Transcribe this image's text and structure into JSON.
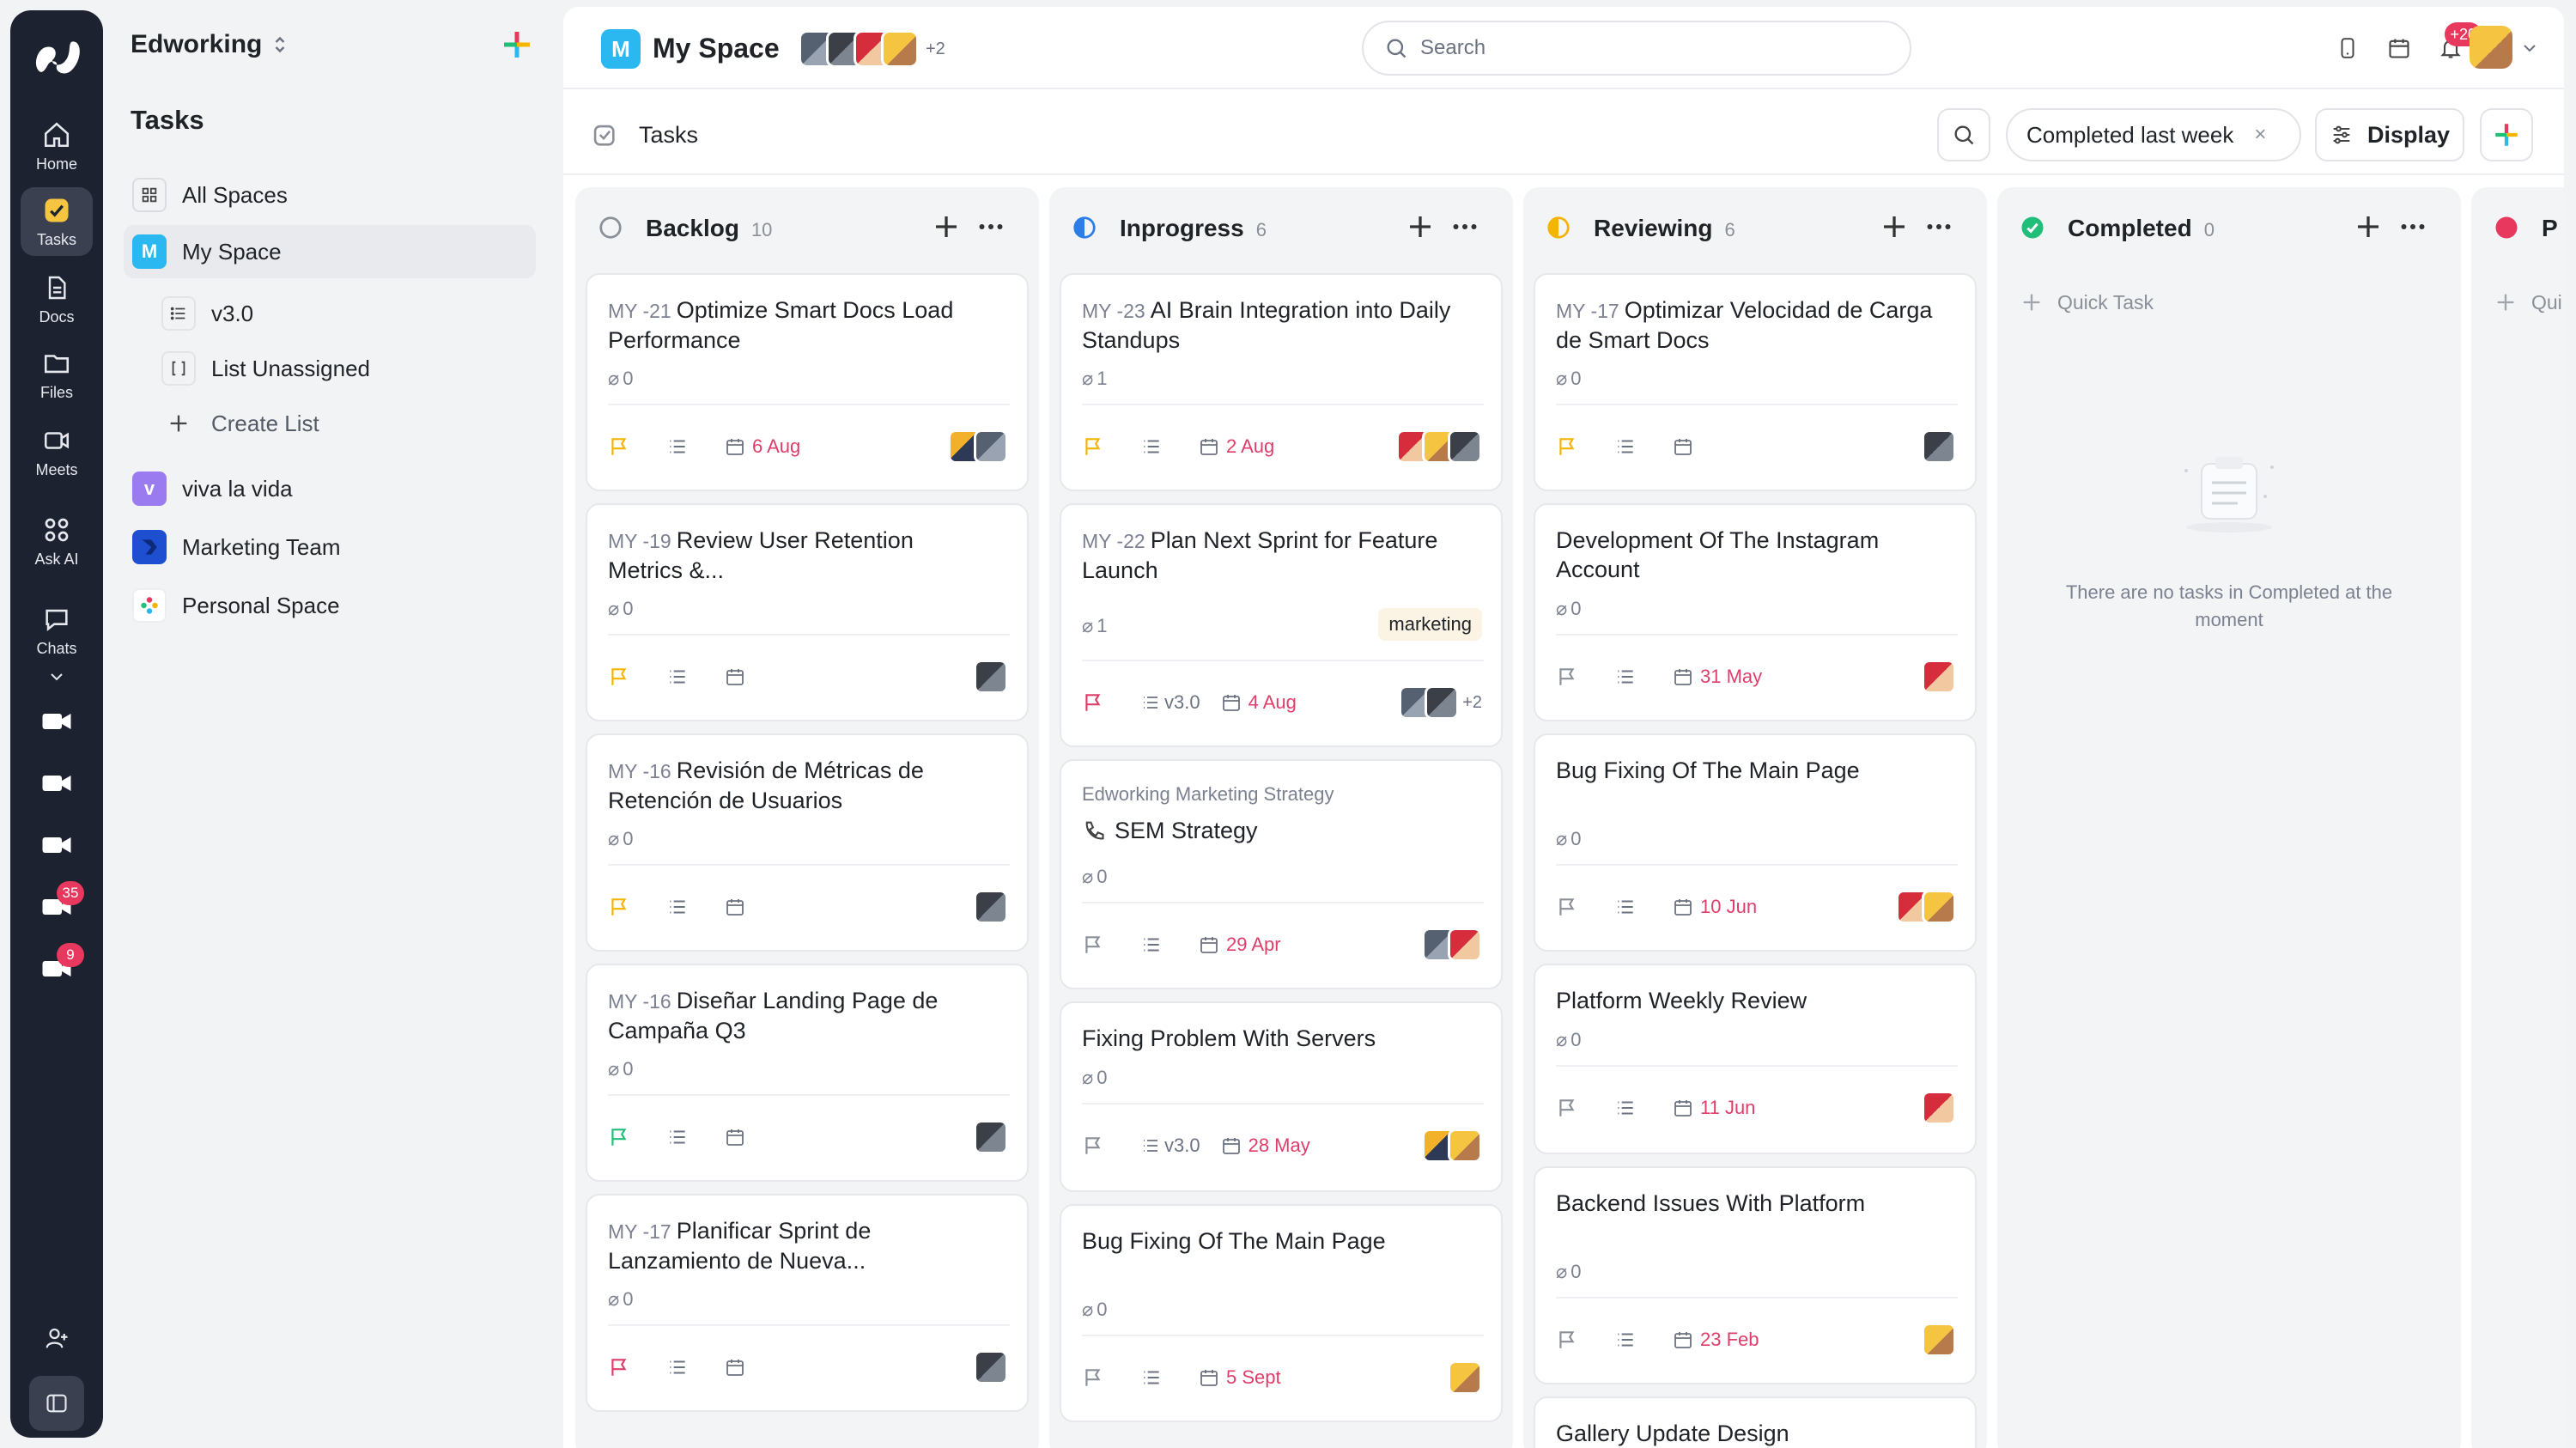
{
  "rail": {
    "items": [
      {
        "label": "Home",
        "icon": "home-icon"
      },
      {
        "label": "Tasks",
        "icon": "tasks-icon"
      },
      {
        "label": "Docs",
        "icon": "docs-icon"
      },
      {
        "label": "Files",
        "icon": "folder-icon"
      },
      {
        "label": "Meets",
        "icon": "video-icon"
      },
      {
        "label": "Ask AI",
        "icon": "ai-icon"
      },
      {
        "label": "Chats",
        "icon": "chat-icon"
      }
    ],
    "badges": {
      "meet4": "35",
      "meet5": "9"
    }
  },
  "sidebar": {
    "workspace": "Edworking",
    "title": "Tasks",
    "items": [
      {
        "label": "All Spaces"
      },
      {
        "label": "My Space",
        "badge": "M"
      },
      {
        "label": "v3.0"
      },
      {
        "label": "List Unassigned"
      },
      {
        "label": "Create List"
      },
      {
        "label": "viva la vida",
        "badge": "v"
      },
      {
        "label": "Marketing Team"
      },
      {
        "label": "Personal Space"
      }
    ]
  },
  "topbar": {
    "space_badge": "M",
    "space_title": "My Space",
    "members_more": "+2",
    "search_placeholder": "Search",
    "notifications_count": "+20"
  },
  "subbar": {
    "title": "Tasks",
    "filter": "Completed last week",
    "filter_clear": "×",
    "display": "Display"
  },
  "columns": [
    {
      "name": "Backlog",
      "count": "10",
      "status_color": "#8a8f98",
      "cards": [
        {
          "code": "MY -21",
          "title": "Optimize Smart Docs Load Performance",
          "attach": "0",
          "flag": "#f5b400",
          "date": "6 Aug"
        },
        {
          "code": "MY -19",
          "title": "Review User Retention Metrics &...",
          "attach": "0",
          "flag": "#f5b400",
          "date": ""
        },
        {
          "code": "MY -16",
          "title": "Revisión de Métricas de Retención de Usuarios",
          "attach": "0",
          "flag": "#f5b400",
          "date": ""
        },
        {
          "code": "MY -16",
          "title": "Diseñar Landing Page de Campaña Q3",
          "attach": "0",
          "flag": "#1fbf7a",
          "date": ""
        },
        {
          "code": "MY -17",
          "title": "Planificar Sprint de Lanzamiento de Nueva...",
          "attach": "0",
          "flag": "#e03e6a",
          "date": ""
        }
      ]
    },
    {
      "name": "Inprogress",
      "count": "6",
      "status_color": "#2b7de9",
      "cards": [
        {
          "code": "MY -23",
          "title": "AI Brain Integration into Daily Standups",
          "attach": "1",
          "flag": "#f5b400",
          "date": "2 Aug"
        },
        {
          "code": "MY -22",
          "title": "Plan Next Sprint for Feature Launch",
          "attach": "1",
          "flag": "#e03e6a",
          "list": "v3.0",
          "date": "4 Aug",
          "tag": "marketing",
          "more": "+2"
        },
        {
          "pre": "Edworking Marketing Strategy",
          "title": "SEM Strategy",
          "attach": "0",
          "flag": "#8a8f98",
          "date": "29 Apr"
        },
        {
          "title": "Fixing Problem With Servers",
          "attach": "0",
          "flag": "#8a8f98",
          "list": "v3.0",
          "date": "28 May"
        },
        {
          "title": "Bug Fixing Of The Main Page",
          "attach": "0",
          "flag": "#8a8f98",
          "date": "5 Sept"
        }
      ]
    },
    {
      "name": "Reviewing",
      "count": "6",
      "status_color": "#f5b400",
      "cards": [
        {
          "code": "MY -17",
          "title": "Optimizar Velocidad de Carga de Smart Docs",
          "attach": "0",
          "flag": "#f5b400",
          "date": ""
        },
        {
          "title": "Development Of The Instagram Account",
          "attach": "0",
          "flag": "#8a8f98",
          "date": "31 May"
        },
        {
          "title": "Bug Fixing Of The Main Page",
          "attach": "0",
          "flag": "#8a8f98",
          "date": "10 Jun"
        },
        {
          "title": "Platform Weekly Review",
          "attach": "0",
          "flag": "#8a8f98",
          "date": "11 Jun"
        },
        {
          "title": "Backend Issues With Platform",
          "attach": "0",
          "flag": "#8a8f98",
          "date": "23 Feb"
        },
        {
          "title": "Gallery Update Design"
        }
      ]
    },
    {
      "name": "Completed",
      "count": "0",
      "status_color": "#1fbf7a",
      "quick_task": "Quick Task",
      "empty": "There are no tasks in Completed at the moment"
    },
    {
      "name": "P",
      "status_color": "#e8385e",
      "quick_task": "Qui"
    }
  ],
  "colors": {
    "accent_red": "#e03e6a",
    "space_blue": "#2bb8f0",
    "rail_bg": "#1d2230"
  }
}
